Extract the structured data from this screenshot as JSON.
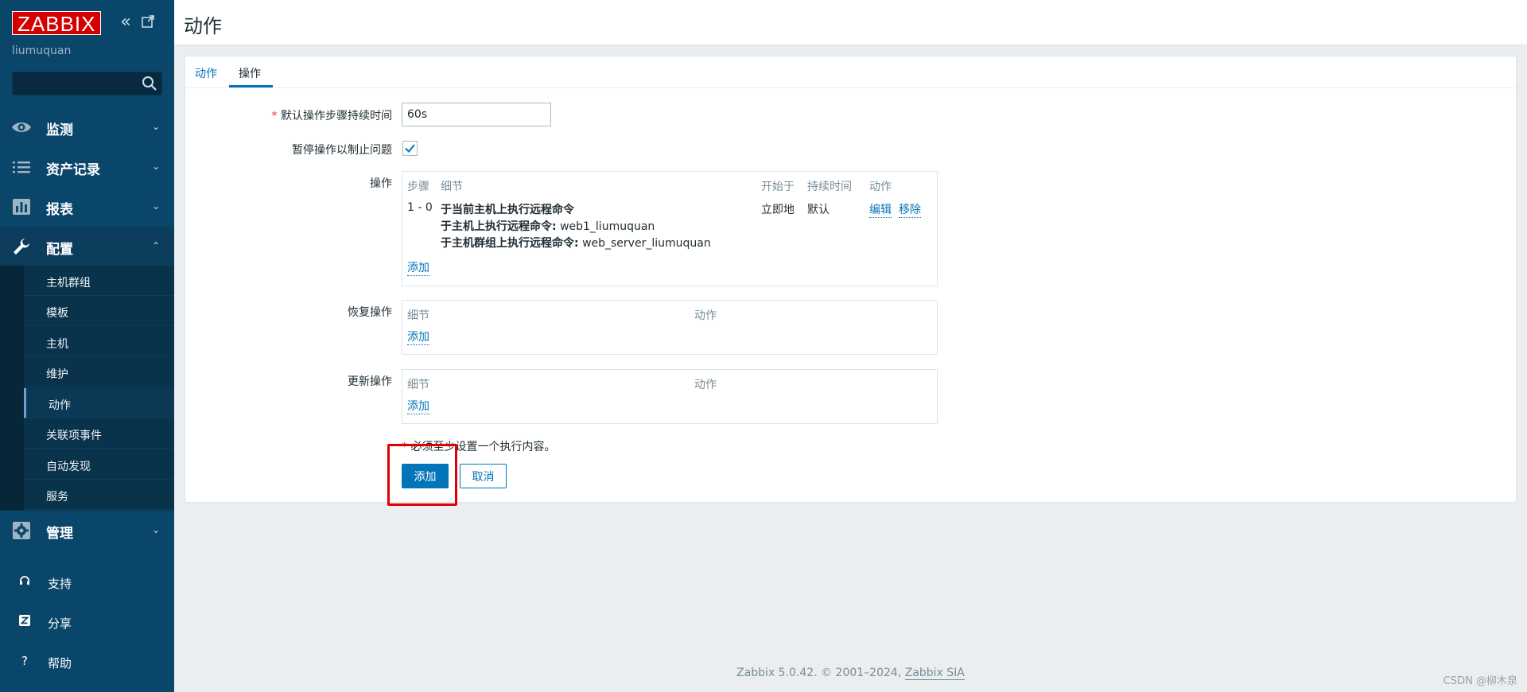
{
  "sidebar": {
    "logo": "ZABBIX",
    "username": "liumuquan",
    "search": {
      "value": "",
      "placeholder": ""
    },
    "nav": [
      {
        "label": "监测",
        "icon": "eye-icon"
      },
      {
        "label": "资产记录",
        "icon": "list-icon"
      },
      {
        "label": "报表",
        "icon": "bar-chart-icon"
      },
      {
        "label": "配置",
        "icon": "wrench-icon"
      },
      {
        "label": "管理",
        "icon": "gear-icon"
      }
    ],
    "submenu": [
      "主机群组",
      "模板",
      "主机",
      "维护",
      "动作",
      "关联项事件",
      "自动发现",
      "服务"
    ],
    "bottom": [
      {
        "label": "支持",
        "icon": "headset-icon"
      },
      {
        "label": "分享",
        "icon": "share-icon"
      },
      {
        "label": "帮助",
        "icon": "help-icon"
      }
    ]
  },
  "header": {
    "title": "动作"
  },
  "tabs": [
    "动作",
    "操作"
  ],
  "form": {
    "duration_label": "默认操作步骤持续时间",
    "duration_value": "60s",
    "pause_label": "暂停操作以制止问题",
    "pause_checked": true,
    "operations_label": "操作",
    "operations_headers": {
      "steps": "步骤",
      "details": "细节",
      "start": "开始于",
      "duration": "持续时间",
      "action": "动作"
    },
    "operation_row": {
      "steps": "1 - 0",
      "detail1": "于当前主机上执行远程命令",
      "detail2_label": "于主机上执行远程命令:",
      "detail2_value": "web1_liumuquan",
      "detail3_label": "于主机群组上执行远程命令:",
      "detail3_value": "web_server_liumuquan",
      "start": "立即地",
      "duration": "默认",
      "edit": "编辑",
      "remove": "移除"
    },
    "add_link": "添加",
    "recovery_label": "恢复操作",
    "update_label": "更新操作",
    "sub_headers": {
      "details": "细节",
      "action": "动作"
    },
    "required_note": "必须至少设置一个执行内容。",
    "add_button": "添加",
    "cancel_button": "取消"
  },
  "footer": {
    "text": "Zabbix 5.0.42. © 2001–2024,",
    "link": "Zabbix SIA"
  },
  "watermark": "CSDN @柳木泉",
  "colors": {
    "sidebar": "#0a466a",
    "accent": "#0275b8",
    "logo": "#d40000",
    "highlight": "#e10000"
  }
}
